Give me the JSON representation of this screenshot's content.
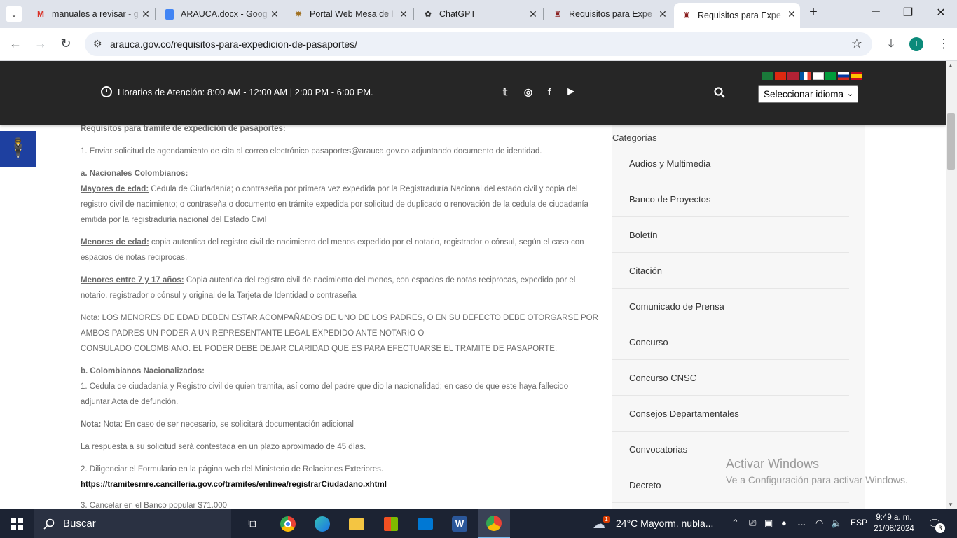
{
  "tabs": [
    {
      "title": "manuales a revisar - g",
      "icon": "gmail-icon"
    },
    {
      "title": "ARAUCA.docx - Goog",
      "icon": "docs-icon"
    },
    {
      "title": "Portal Web Mesa de l",
      "icon": "portal-icon"
    },
    {
      "title": "ChatGPT",
      "icon": "chatgpt-icon"
    },
    {
      "title": "Requisitos para Expe",
      "icon": "arauca-icon"
    },
    {
      "title": "Requisitos para Expe",
      "icon": "arauca-icon"
    }
  ],
  "address": {
    "url": "arauca.gov.co/requisitos-para-expedicion-de-pasaportes/",
    "profile_initial": "I"
  },
  "header": {
    "hours": "Horarios de Atención: 8:00 AM - 12:00 AM | 2:00 PM - 6:00 PM.",
    "language_select": "Seleccionar idioma"
  },
  "content": {
    "title": "Requisitos para tramite de expedición de pasaportes:",
    "step1": "1. Enviar solicitud de agendamiento de cita al correo electrónico pasaportes@arauca.gov.co adjuntando documento de identidad.",
    "section_a": "a. Nacionales Colombianos:",
    "mayores_label": "Mayores de edad:",
    "mayores_text": " Cedula de Ciudadanía; o contraseña por primera vez expedida por la Registraduría Nacional del estado civil y copia del registro civil de nacimiento; o contraseña o documento en trámite expedida por solicitud de duplicado o renovación de la cedula de ciudadanía emitida por la registraduría nacional del Estado Civil",
    "menores_label": "Menores de edad:",
    "menores_text": " copia autentica del registro civil de nacimiento del menos expedido por el notario, registrador o cónsul, según el caso con espacios de notas reciprocas.",
    "menores717_label": "Menores entre 7 y 17 años:",
    "menores717_text": " Copia autentica del registro civil de nacimiento del menos, con espacios de notas reciprocas, expedido por el notario, registrador o cónsul y original de la Tarjeta de Identidad o contraseña",
    "nota_line1": "Nota: LOS MENORES DE EDAD DEBEN ESTAR ACOMPAÑADOS DE UNO DE LOS PADRES, O EN SU DEFECTO DEBE OTORGARSE POR AMBOS PADRES UN PODER A UN REPRESENTANTE LEGAL EXPEDIDO ANTE NOTARIO O",
    "nota_line2": "CONSULADO COLOMBIANO. EL PODER DEBE DEJAR CLARIDAD QUE ES PARA EFECTUARSE EL TRAMITE DE PASAPORTE.",
    "section_b": "b. Colombianos Nacionalizados:",
    "section_b_text": "1. Cedula de ciudadanía y Registro civil de quien tramita, así como del padre que dio la nacionalidad; en caso de que este haya fallecido adjuntar Acta de defunción.",
    "nota2_label": "Nota:",
    "nota2_text": " Nota: En caso de ser necesario, se solicitará documentación adicional",
    "respuesta": "La respuesta a su solicitud será contestada en un plazo aproximado de 45 días.",
    "step2": "2. Diligenciar el Formulario en la página web del Ministerio de Relaciones Exteriores.",
    "step2_link": "https://tramitesmre.cancilleria.gov.co/tramites/enlinea/registrarCiudadano.xhtml",
    "step3": "3. Cancelar en el Banco popular $71.000"
  },
  "sidebar": {
    "heading": "Categorías",
    "items": [
      "Audios y Multimedia",
      "Banco de Proyectos",
      "Boletín",
      "Citación",
      "Comunicado de Prensa",
      "Concurso",
      "Concurso CNSC",
      "Consejos Departamentales",
      "Convocatorias",
      "Decreto"
    ]
  },
  "watermark": {
    "line1": "Activar Windows",
    "line2": "Ve a Configuración para activar Windows."
  },
  "taskbar": {
    "search": "Buscar",
    "weather": "24°C  Mayorm. nubla...",
    "lang": "ESP",
    "time": "9:49 a. m.",
    "date": "21/08/2024",
    "notif_count": "3",
    "weather_badge": "1"
  },
  "colors": {
    "topbar": "#262626",
    "accessibility": "#1e40a0",
    "taskbar": "#1c2333",
    "tabbar": "#dfe3eb"
  }
}
